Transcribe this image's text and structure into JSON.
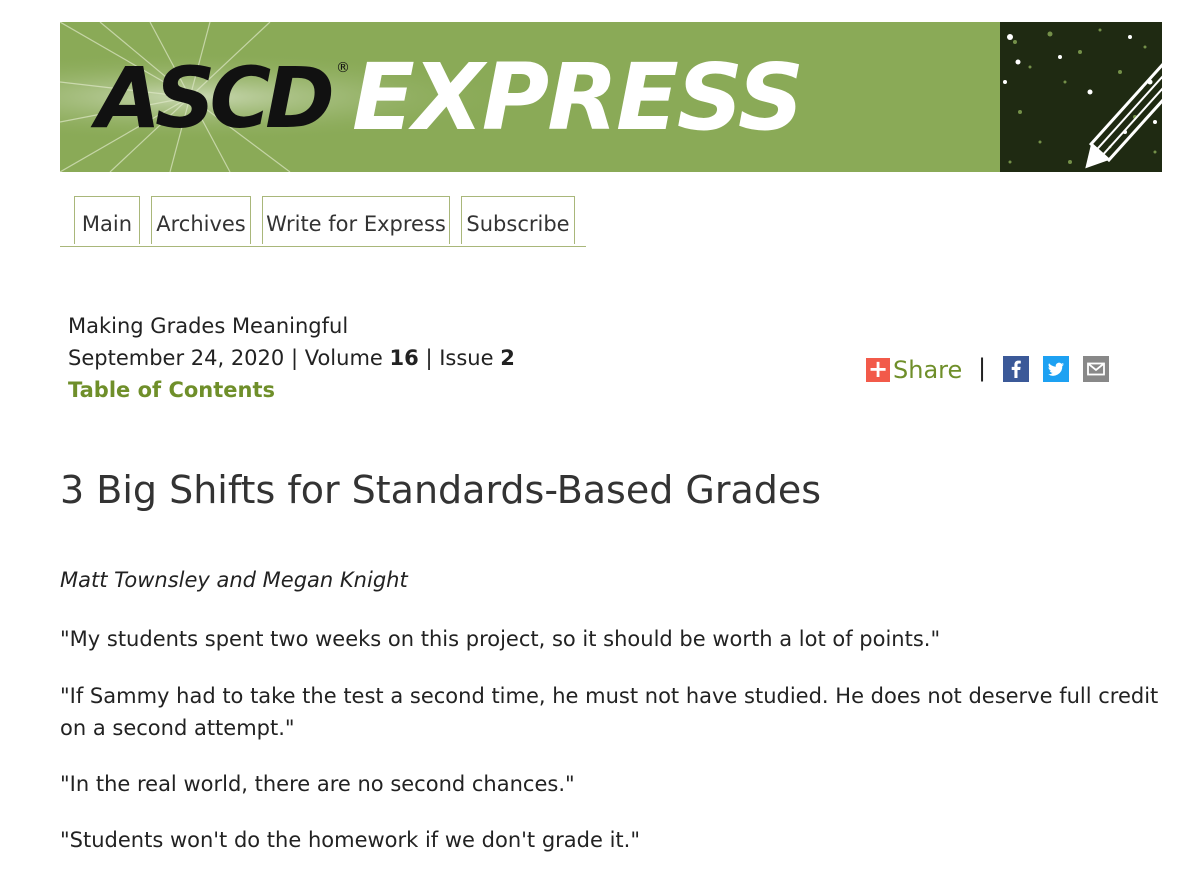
{
  "banner": {
    "logo": "ASCD",
    "registered": "®",
    "title": "EXPRESS",
    "colors": {
      "background": "#8aaa57",
      "logo": "#111111",
      "title": "#ffffff"
    }
  },
  "nav": {
    "tabs": [
      {
        "label": "Main"
      },
      {
        "label": "Archives"
      },
      {
        "label": "Write for Express"
      },
      {
        "label": "Subscribe"
      }
    ]
  },
  "issue": {
    "theme": "Making Grades Meaningful",
    "date": "September 24, 2020",
    "volume_label": "Volume",
    "volume": "16",
    "issue_label": "Issue",
    "issue_number": "2",
    "separator": "|",
    "toc": "Table of Contents"
  },
  "share": {
    "plus": "+",
    "label": "Share",
    "separator": "|",
    "icons": [
      "facebook-icon",
      "twitter-icon",
      "email-icon"
    ],
    "colors": {
      "plus_bg": "#f25a4a",
      "label": "#6f8f2a",
      "facebook": "#3b5998",
      "twitter": "#1da1f2",
      "email": "#888888"
    }
  },
  "article": {
    "title": "3 Big Shifts for Standards-Based Grades",
    "authors": "Matt Townsley and Megan Knight",
    "paragraphs": [
      "\"My students spent two weeks on this project, so it should be worth a lot of points.\"",
      "\"If Sammy had to take the test a second time, he must not have studied. He does not deserve full credit on a second attempt.\"",
      "\"In the real world, there are no second chances.\"",
      "\"Students won't do the homework if we don't grade it.\""
    ]
  }
}
